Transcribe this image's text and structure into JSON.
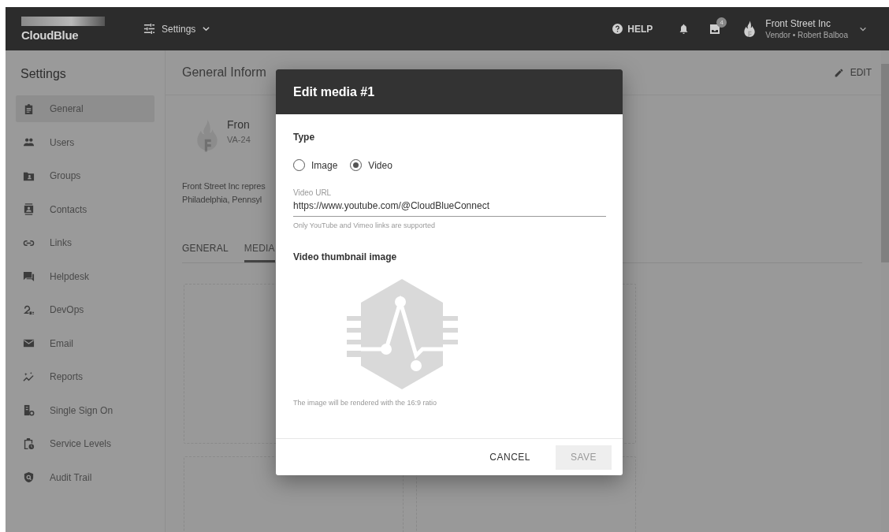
{
  "topbar": {
    "logo": "CloudBlue",
    "menu": {
      "label": "Settings"
    },
    "help": "HELP",
    "inbox_badge": "4",
    "account": {
      "name": "Front Street Inc",
      "role": "Vendor • Robert Balboa"
    }
  },
  "sidebar": {
    "title": "Settings",
    "items": [
      {
        "label": "General",
        "selected": true
      },
      {
        "label": "Users",
        "selected": false
      },
      {
        "label": "Groups",
        "selected": false
      },
      {
        "label": "Contacts",
        "selected": false
      },
      {
        "label": "Links",
        "selected": false
      },
      {
        "label": "Helpdesk",
        "selected": false
      },
      {
        "label": "DevOps",
        "selected": false
      },
      {
        "label": "Email",
        "selected": false
      },
      {
        "label": "Reports",
        "selected": false
      },
      {
        "label": "Single Sign On",
        "selected": false
      },
      {
        "label": "Service Levels",
        "selected": false
      },
      {
        "label": "Audit Trail",
        "selected": false
      }
    ]
  },
  "content": {
    "title": "General Inform",
    "edit": "EDIT",
    "company": {
      "name": "Fron",
      "id": "VA-24"
    },
    "description": [
      "Front Street Inc repres",
      "Philadelphia, Pennsyl"
    ],
    "tabs": [
      {
        "label": "GENERAL",
        "selected": false
      },
      {
        "label": "MEDIA",
        "selected": true
      }
    ]
  },
  "dialog": {
    "title": "Edit media #1",
    "type_label": "Type",
    "options": [
      {
        "label": "Image",
        "selected": false
      },
      {
        "label": "Video",
        "selected": true
      }
    ],
    "url_field": {
      "label": "Video URL",
      "value": "https://www.youtube.com/@CloudBlueConnect",
      "hint": "Only YouTube and Vimeo links are supported"
    },
    "thumbnail": {
      "label": "Video thumbnail image",
      "caption": "The image will be rendered with the 16:9 ratio"
    },
    "buttons": [
      {
        "label": "CANCEL",
        "disabled": false
      },
      {
        "label": "SAVE",
        "disabled": true
      }
    ]
  }
}
